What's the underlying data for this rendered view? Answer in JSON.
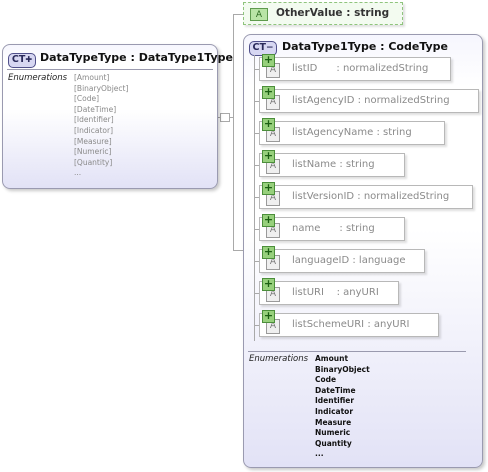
{
  "left_type": {
    "badge": "CT",
    "title": "DataTypeType : DataType1Type",
    "enum_label": "Enumerations",
    "enum_values": [
      "[Amount]",
      "[BinaryObject]",
      "[Code]",
      "[DateTime]",
      "[Identifier]",
      "[Indicator]",
      "[Measure]",
      "[Numeric]",
      "[Quantity]",
      "..."
    ]
  },
  "other_value": {
    "icon": "A",
    "label": "OtherValue : string"
  },
  "right_type": {
    "badge": "CT",
    "title": "DataType1Type : CodeType",
    "attributes": [
      {
        "icon": "A",
        "label": "listID      : normalizedString"
      },
      {
        "icon": "A",
        "label": "listAgencyID : normalizedString"
      },
      {
        "icon": "A",
        "label": "listAgencyName : string"
      },
      {
        "icon": "A",
        "label": "listName : string"
      },
      {
        "icon": "A",
        "label": "listVersionID : normalizedString"
      },
      {
        "icon": "A",
        "label": "name      : string"
      },
      {
        "icon": "A",
        "label": "languageID : language"
      },
      {
        "icon": "A",
        "label": "listURI    : anyURI"
      },
      {
        "icon": "A",
        "label": "listSchemeURI : anyURI"
      }
    ],
    "enum_label": "Enumerations",
    "enum_values": [
      "Amount",
      "BinaryObject",
      "Code",
      "DateTime",
      "Identifier",
      "Indicator",
      "Measure",
      "Numeric",
      "Quantity",
      "..."
    ]
  },
  "icons": {
    "expand": "plus-icon",
    "collapse": "minus-icon",
    "attribute": "attribute-icon"
  },
  "colors": {
    "type_badge_bg": "#d7d7f2",
    "plus_green": "#97d07c",
    "element_border": "#8fc47d",
    "connector": "#a9a9a9"
  }
}
